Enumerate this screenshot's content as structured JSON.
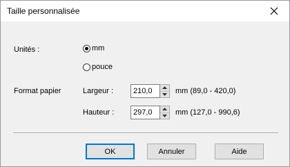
{
  "dialog": {
    "title": "Taille personnalisée",
    "close_icon": "close-icon"
  },
  "units": {
    "label": "Unités :",
    "options": [
      {
        "label": "mm",
        "selected": true
      },
      {
        "label": "pouce",
        "selected": false
      }
    ]
  },
  "paper": {
    "label": "Format papier",
    "width": {
      "label": "Largeur :",
      "value": "210,0",
      "range": "mm (89,0 - 420,0)"
    },
    "height": {
      "label": "Hauteur :",
      "value": "297,0",
      "range": "mm (127,0 - 990,6)"
    }
  },
  "buttons": {
    "ok": "OK",
    "cancel": "Annuler",
    "help": "Aide"
  },
  "colors": {
    "accent": "#0078d7",
    "dialog_bg": "#f0f0f0",
    "title_bg": "#ffffff"
  }
}
